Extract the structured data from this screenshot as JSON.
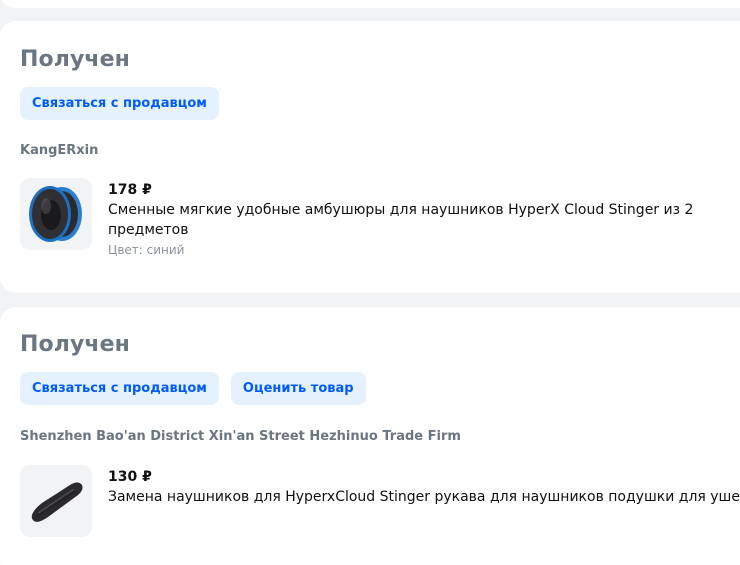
{
  "orders": [
    {
      "status": "Получен",
      "actions": {
        "contact_seller": "Связаться с продавцом"
      },
      "seller": "KangERxin",
      "product": {
        "price": "178 ₽",
        "title": "Сменные мягкие удобные амбушюры для наушников HyperX Cloud Stinger из 2 предметов",
        "variant": "Цвет: синий",
        "image_icon": "earpads-icon"
      }
    },
    {
      "status": "Получен",
      "actions": {
        "contact_seller": "Связаться с продавцом",
        "rate_product": "Оценить товар"
      },
      "seller": "Shenzhen Bao'an District Xin'an Street Hezhinuo Trade Firm",
      "product": {
        "price": "130 ₽",
        "title": "Замена наушников для HyperxCloud Stinger рукава для наушников подушки для ушей",
        "image_icon": "headband-cushion-icon"
      }
    }
  ],
  "colors": {
    "accent": "#005bff",
    "button_bg": "#e5f2fe",
    "status_text": "#6b7682",
    "page_bg": "#f2f3f5"
  }
}
